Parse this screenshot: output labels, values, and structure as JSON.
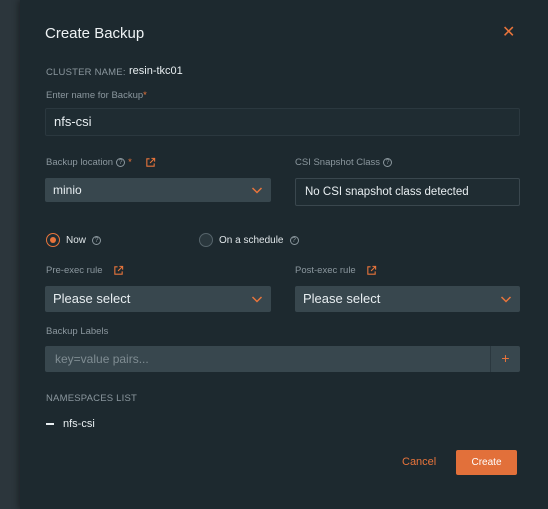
{
  "modal": {
    "title": "Create Backup",
    "close_glyph": "✕"
  },
  "cluster": {
    "label": "CLUSTER NAME:",
    "value": "resin-tkc01"
  },
  "backup_name": {
    "label": "Enter name for Backup",
    "required_mark": "*",
    "value": "nfs-csi"
  },
  "backup_location": {
    "label": "Backup location",
    "required_mark": "*",
    "help_glyph": "?",
    "selected": "minio"
  },
  "csi_snapshot": {
    "label": "CSI Snapshot Class",
    "help_glyph": "?",
    "value": "No CSI snapshot class detected"
  },
  "schedule": {
    "now_label": "Now",
    "scheduled_label": "On a schedule",
    "help_glyph": "?",
    "selected": "now"
  },
  "pre_exec": {
    "label": "Pre-exec rule",
    "selected": "Please select"
  },
  "post_exec": {
    "label": "Post-exec rule",
    "selected": "Please select"
  },
  "backup_labels": {
    "label": "Backup Labels",
    "placeholder": "key=value pairs...",
    "add_glyph": "+"
  },
  "namespaces": {
    "label": "NAMESPACES LIST",
    "items": [
      "nfs-csi"
    ]
  },
  "actions": {
    "cancel_label": "Cancel",
    "create_label": "Create"
  },
  "colors": {
    "accent": "#e8743b",
    "panel": "#1d292f",
    "backdrop": "#263036",
    "select_bg": "#38474e"
  },
  "icons": {
    "external_link": "external-link-icon",
    "help": "help-circle-icon",
    "chevron": "chevron-down-icon",
    "close": "close-icon",
    "add": "plus-icon"
  }
}
